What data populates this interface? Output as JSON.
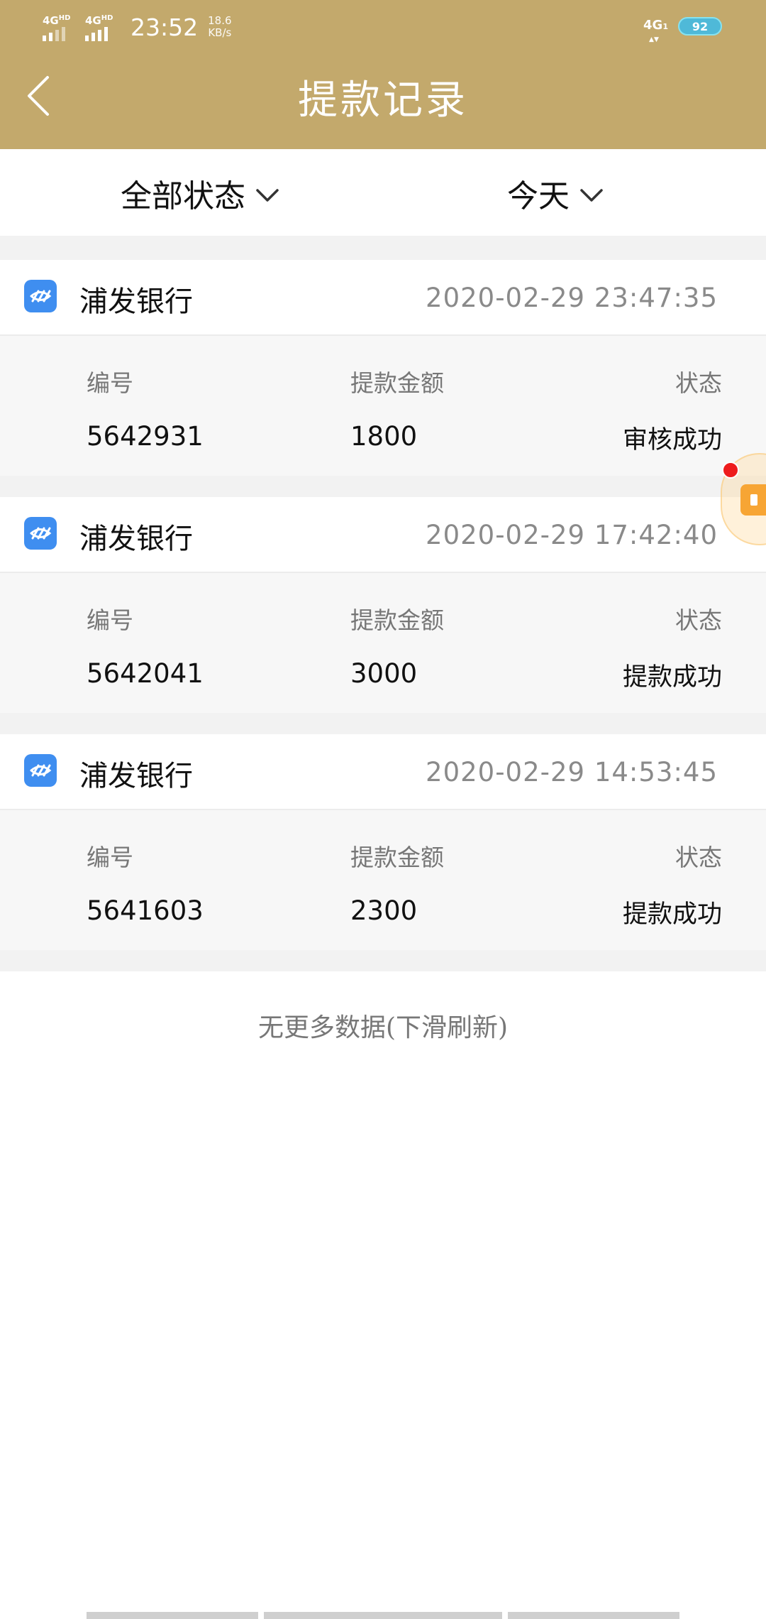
{
  "status_bar": {
    "sim1": "4G",
    "sim1_sup": "HD",
    "sim2": "4G",
    "sim2_sup": "HD",
    "time": "23:52",
    "net_speed_value": "18.6",
    "net_speed_unit": "KB/s",
    "network": "4G",
    "battery": "92"
  },
  "header": {
    "back_icon": "chevron-left-icon",
    "title": "提款记录"
  },
  "filters": {
    "status_label": "全部状态",
    "date_label": "今天",
    "chevron_icon": "chevron-down-icon"
  },
  "column_headers": {
    "number": "编号",
    "amount": "提款金额",
    "status": "状态"
  },
  "records": [
    {
      "bank": "浦发银行",
      "datetime": "2020-02-29  23:47:35",
      "number": "5642931",
      "amount": "1800",
      "status": "审核成功"
    },
    {
      "bank": "浦发银行",
      "datetime": "2020-02-29  17:42:40",
      "number": "5642041",
      "amount": "3000",
      "status": "提款成功"
    },
    {
      "bank": "浦发银行",
      "datetime": "2020-02-29  14:53:45",
      "number": "5641603",
      "amount": "2300",
      "status": "提款成功"
    }
  ],
  "footer": {
    "no_more": "无更多数据(下滑刷新)"
  },
  "colors": {
    "header_bg": "#c3a96c",
    "bank_logo": "#3f8ef0",
    "notification_dot": "#ee1c1c"
  }
}
